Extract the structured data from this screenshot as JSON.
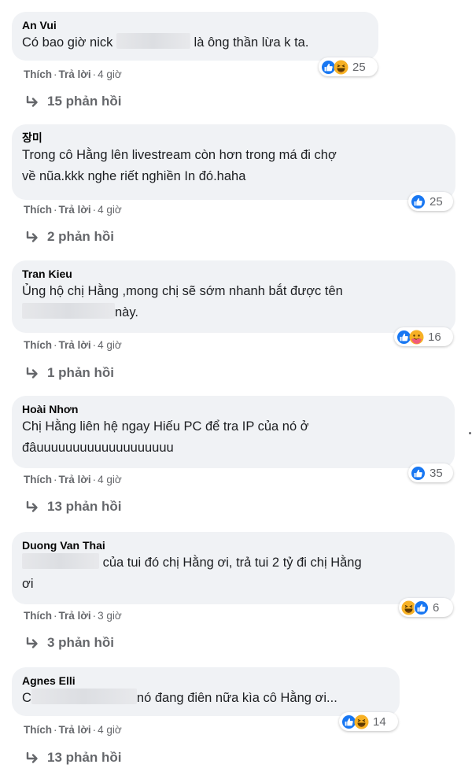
{
  "ui": {
    "like_label": "Thích",
    "reply_label": "Trả lời",
    "separator": "·",
    "colors": {
      "bubble": "#f0f2f5",
      "meta": "#65676b",
      "like": "#1877f2",
      "haha": "#f7b125"
    }
  },
  "comments": [
    {
      "author": "An Vui",
      "text_before": "Có bao giờ nick ",
      "text_after": " là ông thần lừa k ta.",
      "time": "4 giờ",
      "reactions": [
        "like-icon",
        "haha-icon"
      ],
      "reaction_count": "25",
      "replies": "15 phản hồi"
    },
    {
      "author": "장미",
      "line1": "Trong cô Hằng lên livestream còn hơn trong má đi chợ",
      "line2": "về nũa.kkk nghe riết nghiền In đó.haha",
      "time": "4 giờ",
      "reactions": [
        "like-icon"
      ],
      "reaction_count": "25",
      "replies": "2 phản hồi"
    },
    {
      "author": "Tran Kieu",
      "line1": "Ủng hộ chị Hằng ,mong chị sẽ sớm nhanh bắt được tên",
      "line2_after": "này.",
      "time": "4 giờ",
      "reactions": [
        "like-icon",
        "care-icon"
      ],
      "reaction_count": "16",
      "replies": "1 phản hồi"
    },
    {
      "author": "Hoài Nhơn",
      "line1": "Chị Hằng liên hệ ngay Hiếu PC để tra IP của nó ở",
      "line2": "đâuuuuuuuuuuuuuuuuuuu",
      "time": "4 giờ",
      "reactions": [
        "like-icon"
      ],
      "reaction_count": "35",
      "replies": "13 phản hồi"
    },
    {
      "author": "Duong Van Thai",
      "line1_after": " của tui đó chị Hằng ơi, trả tui 2 tỷ đi chị Hằng",
      "line2": "ơi",
      "time": "3 giờ",
      "reactions": [
        "haha-icon",
        "like-icon"
      ],
      "reaction_count": "6",
      "replies": "3 phản hồi"
    },
    {
      "author": "Agnes Elli",
      "text_before": "C",
      "text_after": "nó đang điên nữa kìa cô Hằng ơi...",
      "time": "4 giờ",
      "reactions": [
        "like-icon",
        "haha-icon"
      ],
      "reaction_count": "14",
      "replies": "13 phản hồi"
    }
  ]
}
